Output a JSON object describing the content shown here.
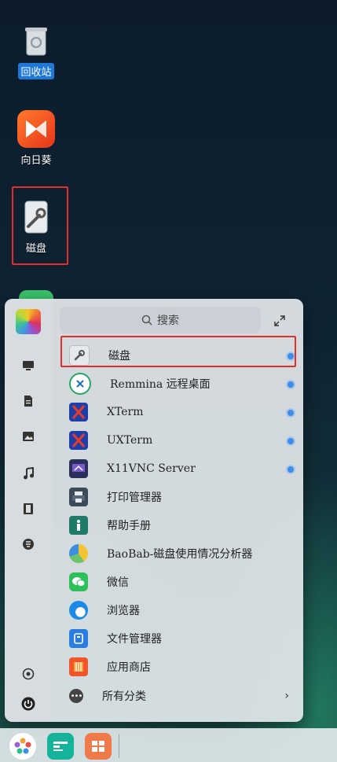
{
  "desktop": {
    "icons": [
      {
        "label": "回收站",
        "icon": "trash-icon",
        "selected": true
      },
      {
        "label": "向日葵",
        "icon": "sunlogin-icon",
        "selected": false
      },
      {
        "label": "磁盘",
        "icon": "disk-tool-icon",
        "selected": false
      }
    ]
  },
  "menu": {
    "search_placeholder": "搜索",
    "sidebar": [
      "avatar",
      "computer-icon",
      "document-icon",
      "picture-icon",
      "music-icon",
      "video-icon",
      "download-icon",
      "settings-icon",
      "power-icon"
    ],
    "apps": [
      {
        "name": "磁盘",
        "icon": "disk-tool-icon",
        "new": true
      },
      {
        "name": "Remmina 远程桌面",
        "icon": "remmina-icon",
        "new": true
      },
      {
        "name": "XTerm",
        "icon": "xterm-icon",
        "new": true
      },
      {
        "name": "UXTerm",
        "icon": "uxterm-icon",
        "new": true
      },
      {
        "name": "X11VNC Server",
        "icon": "x11vnc-icon",
        "new": true
      },
      {
        "name": "打印管理器",
        "icon": "printer-icon",
        "new": false
      },
      {
        "name": "帮助手册",
        "icon": "help-icon",
        "new": false
      },
      {
        "name": "BaoBab-磁盘使用情况分析器",
        "icon": "baobab-icon",
        "new": false
      },
      {
        "name": "微信",
        "icon": "wechat-icon",
        "new": false
      },
      {
        "name": "浏览器",
        "icon": "browser-icon",
        "new": false
      },
      {
        "name": "文件管理器",
        "icon": "file-manager-icon",
        "new": false
      },
      {
        "name": "应用商店",
        "icon": "app-store-icon",
        "new": false
      }
    ],
    "all_categories": "所有分类",
    "chevron": "›"
  },
  "taskbar": {
    "items": [
      "start-menu-icon",
      "multitask-icon",
      "workspace-icon"
    ]
  },
  "colors": {
    "highlight_border": "#e0302a",
    "new_dot": "#3d8df0",
    "selected_label_bg": "#1e78d6"
  }
}
